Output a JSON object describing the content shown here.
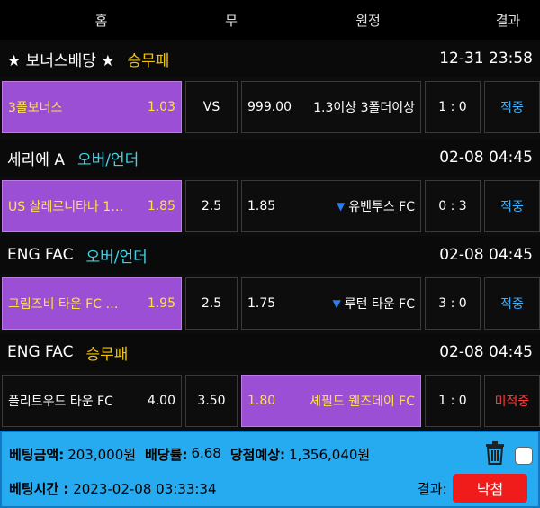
{
  "header": {
    "home": "홈",
    "draw": "무",
    "away": "원정",
    "result": "결과"
  },
  "bets": [
    {
      "league": "★ 보너스배당 ★",
      "market": "승무패",
      "market_color": "yellow",
      "date": "12-31 23:58",
      "home": "3폴보너스",
      "home_odds": "1.03",
      "draw": "VS",
      "away_odds": "999.00",
      "away_arrow": "",
      "away": "1.3이상 3폴더이상",
      "score": "1 : 0",
      "result": "적중",
      "pick": "home"
    },
    {
      "league": "세리에 A",
      "market": "오버/언더",
      "market_color": "cyan",
      "date": "02-08 04:45",
      "home": "US 살레르니타나 1…",
      "home_odds": "1.85",
      "draw": "2.5",
      "away_odds": "1.85",
      "away_arrow": "▼",
      "away": "유벤투스 FC",
      "score": "0 : 3",
      "result": "적중",
      "pick": "home"
    },
    {
      "league": "ENG FAC",
      "market": "오버/언더",
      "market_color": "cyan",
      "date": "02-08 04:45",
      "home": "그림즈비 타운 FC …",
      "home_odds": "1.95",
      "draw": "2.5",
      "away_odds": "1.75",
      "away_arrow": "▼",
      "away": "루턴 타운 FC",
      "score": "3 : 0",
      "result": "적중",
      "pick": "home"
    },
    {
      "league": "ENG FAC",
      "market": "승무패",
      "market_color": "yellow",
      "date": "02-08 04:45",
      "home": "플리트우드 타운 FC",
      "home_odds": "4.00",
      "draw": "3.50",
      "away_odds": "1.80",
      "away_arrow": "",
      "away": "셰필드 웬즈데이 FC",
      "score": "1 : 0",
      "result": "미적중",
      "pick": "away"
    }
  ],
  "footer": {
    "amount_label": "베팅금액:",
    "amount": "203,000원",
    "odds_label": "배당률:",
    "odds": "6.68",
    "expected_label": "당첨예상:",
    "expected": "1,356,040원",
    "time_label": "베팅시간 :",
    "time": "2023-02-08 03:33:34",
    "result_label": "결과:",
    "result_button": "낙첨"
  }
}
